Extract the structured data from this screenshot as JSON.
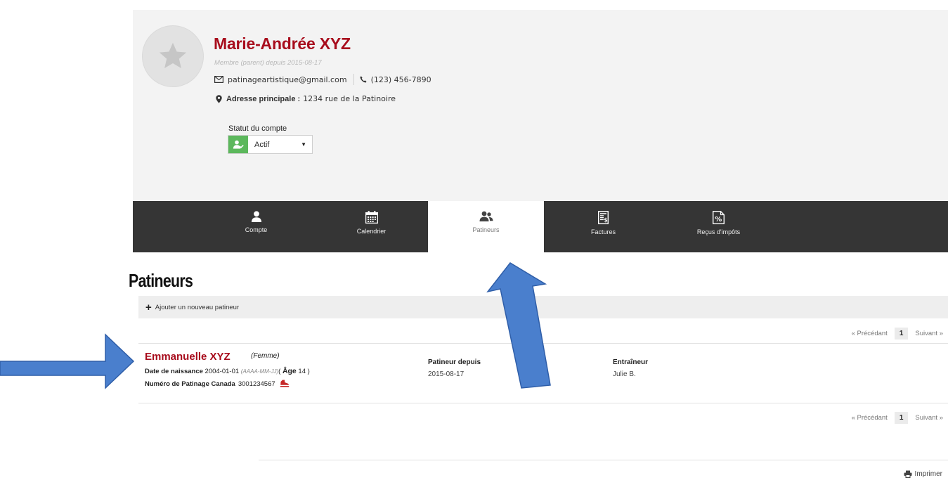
{
  "profile": {
    "name": "Marie-Andrée XYZ",
    "member_since": "Membre (parent) depuis 2015-08-17",
    "email": "patinageartistique@gmail.com",
    "phone": "(123) 456-7890",
    "address_label": "Adresse principale :",
    "address_value": "1234 rue de la Patinoire",
    "status_label": "Statut du compte",
    "status_value": "Actif"
  },
  "nav": {
    "tabs": [
      {
        "label": "Compte",
        "icon": "user-icon"
      },
      {
        "label": "Calendrier",
        "icon": "calendar-icon"
      },
      {
        "label": "Patineurs",
        "icon": "users-icon",
        "active": true
      },
      {
        "label": "Factures",
        "icon": "invoice-icon"
      },
      {
        "label": "Reçus d'impôts",
        "icon": "percent-receipt-icon"
      }
    ]
  },
  "section": {
    "title": "Patineurs",
    "add_label": "Ajouter un nouveau patineur"
  },
  "pager": {
    "prev": "« Précédant",
    "page": "1",
    "next": "Suivant »"
  },
  "skater": {
    "name": "Emmanuelle XYZ",
    "gender": "(Femme)",
    "dob_label": "Date de naissance",
    "dob_value": "2004-01-01",
    "dob_format": "(AAAA-MM-JJ)",
    "age_open": "( ",
    "age_label": "Âge",
    "age_value": " 14 )",
    "number_label": "Numéro de Patinage Canada",
    "number_value": "3001234567",
    "since_label": "Patineur depuis",
    "since_value": "2015-08-17",
    "coach_label": "Entraîneur",
    "coach_value": "Julie B."
  },
  "footer": {
    "print_label": "Imprimer"
  },
  "colors": {
    "brand_red": "#a80d1d",
    "nav_dark": "#353535",
    "status_green": "#5cb85c",
    "arrow_blue": "#4a7fcd"
  }
}
